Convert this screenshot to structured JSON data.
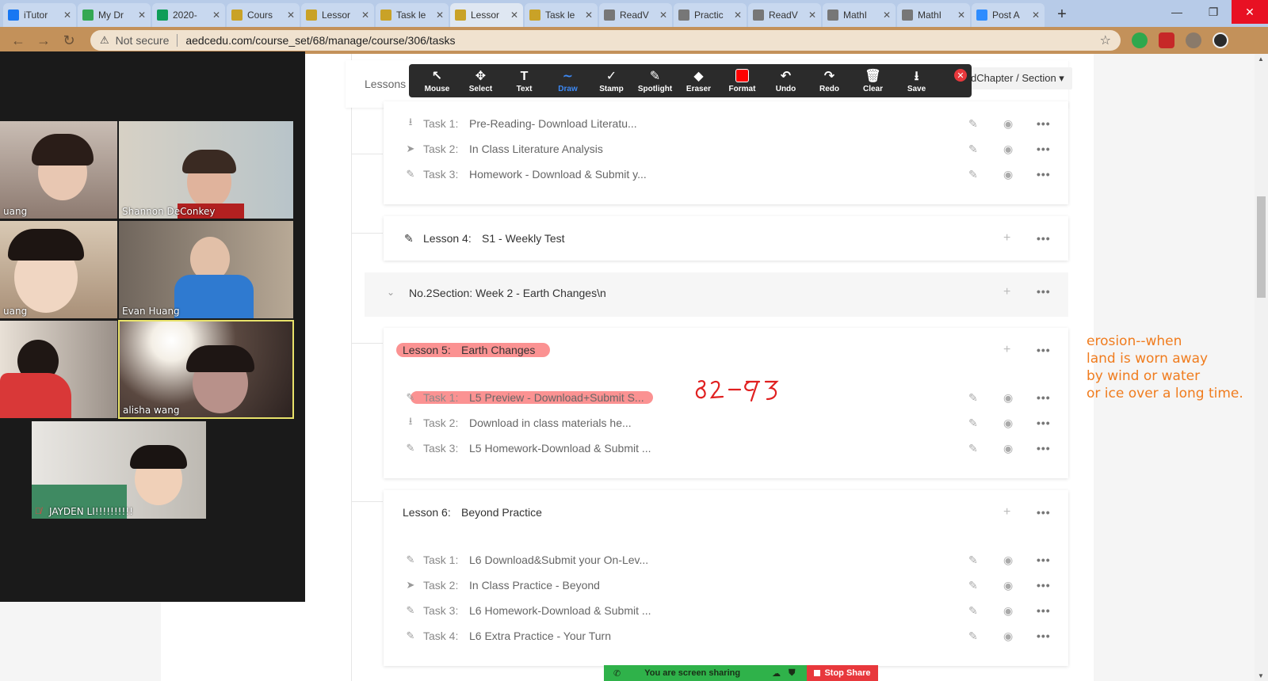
{
  "browser": {
    "tabs": [
      {
        "label": "iTutor",
        "color": "#1877f2"
      },
      {
        "label": "My Dr",
        "color": "#34a853"
      },
      {
        "label": "2020-",
        "color": "#0f9d58"
      },
      {
        "label": "Cours",
        "color": "#c9a227"
      },
      {
        "label": "Lessor",
        "color": "#c9a227"
      },
      {
        "label": "Task le",
        "color": "#c9a227"
      },
      {
        "label": "Lessor",
        "color": "#c9a227"
      },
      {
        "label": "Task le",
        "color": "#c9a227"
      },
      {
        "label": "ReadV",
        "color": "#777777"
      },
      {
        "label": "Practic",
        "color": "#777777"
      },
      {
        "label": "ReadV",
        "color": "#777777"
      },
      {
        "label": "MathI",
        "color": "#777777"
      },
      {
        "label": "MathI",
        "color": "#777777"
      },
      {
        "label": "Post A",
        "color": "#2d8cff"
      }
    ],
    "active_tab_index": 6,
    "security_label": "Not secure",
    "url": "aedcedu.com/course_set/68/manage/course/306/tasks"
  },
  "page": {
    "lessons_label": "Lessons",
    "chapter_button": "dChapter / Section ▾",
    "groups": [
      {
        "type": "tasks",
        "tasks": [
          {
            "icon": "download",
            "num": "Task 1:",
            "name": "Pre-Reading- Download Literatu..."
          },
          {
            "icon": "send",
            "num": "Task 2:",
            "name": "In Class Literature Analysis"
          },
          {
            "icon": "pencil",
            "num": "Task 3:",
            "name": "Homework - Download & Submit y..."
          }
        ]
      }
    ],
    "lesson4": {
      "num": "Lesson 4:",
      "name": "S1 - Weekly Test"
    },
    "section2": {
      "title": "No.2Section:  Week 2 - Earth Changes\\n"
    },
    "lesson5": {
      "num": "Lesson 5:",
      "name": "Earth Changes",
      "tasks": [
        {
          "icon": "pencil",
          "num": "Task 1:",
          "name": "L5 Preview - Download+Submit S..."
        },
        {
          "icon": "download",
          "num": "Task 2:",
          "name": "Download in class materials he..."
        },
        {
          "icon": "pencil",
          "num": "Task 3:",
          "name": "L5 Homework-Download & Submit ..."
        }
      ]
    },
    "lesson6": {
      "num": "Lesson 6:",
      "name": "Beyond Practice",
      "tasks": [
        {
          "icon": "pencil",
          "num": "Task 1:",
          "name": "L6 Download&Submit your On-Lev..."
        },
        {
          "icon": "send",
          "num": "Task 2:",
          "name": "In Class Practice - Beyond"
        },
        {
          "icon": "pencil",
          "num": "Task 3:",
          "name": "L6 Homework-Download & Submit ..."
        },
        {
          "icon": "pencil",
          "num": "Task 4:",
          "name": "L6 Extra Practice - Your Turn"
        }
      ]
    },
    "action_more": "•••"
  },
  "annotations": {
    "note_lines": [
      "erosion--when",
      "land is worn away",
      "by wind or water",
      "or ice over a long time."
    ],
    "handwriting": "82-93",
    "note_color": "#f07c1e",
    "ink_color": "#e02020",
    "highlight_color": "#fa6e6e"
  },
  "zoom_toolbar": {
    "tools": [
      {
        "label": "Mouse",
        "icon": "↖"
      },
      {
        "label": "Select",
        "icon": "✥"
      },
      {
        "label": "Text",
        "icon": "T"
      },
      {
        "label": "Draw",
        "icon": "∼",
        "selected": true
      },
      {
        "label": "Stamp",
        "icon": "✓"
      },
      {
        "label": "Spotlight",
        "icon": "✎"
      },
      {
        "label": "Eraser",
        "icon": "◆"
      },
      {
        "label": "Format",
        "icon": "format"
      },
      {
        "label": "Undo",
        "icon": "↶"
      },
      {
        "label": "Redo",
        "icon": "↷"
      },
      {
        "label": "Clear",
        "icon": "🗑"
      },
      {
        "label": "Save",
        "icon": "⭳"
      }
    ]
  },
  "participants": [
    {
      "name": "uang"
    },
    {
      "name": "Shannon DeConkey"
    },
    {
      "name": "uang"
    },
    {
      "name": "Evan Huang"
    },
    {
      "name": ""
    },
    {
      "name": "alisha wang"
    },
    {
      "name": "JAYDEN LI!!!!!!!!!!"
    }
  ],
  "share_bar": {
    "status": "You are screen sharing",
    "stop_label": "Stop Share"
  }
}
